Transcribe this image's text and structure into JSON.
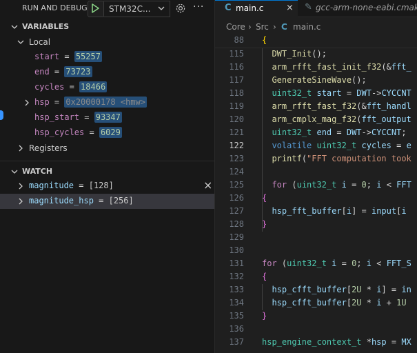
{
  "debug_toolbar": {
    "title": "RUN AND DEBUG",
    "config_label": "STM32C...",
    "play_icon": "play-icon",
    "gear_icon": "gear-icon",
    "more_label": "···"
  },
  "variables": {
    "header": "VARIABLES",
    "local_label": "Local",
    "items": [
      {
        "name": "start",
        "eq": " = ",
        "value": "55257"
      },
      {
        "name": "end",
        "eq": " = ",
        "value": "73723"
      },
      {
        "name": "cycles",
        "eq": " = ",
        "value": "18466"
      },
      {
        "name": "hsp",
        "eq": " = ",
        "value": "0x20000178 <hmw>"
      },
      {
        "name": "hsp_start",
        "eq": " = ",
        "value": "93347"
      },
      {
        "name": "hsp_cycles",
        "eq": " = ",
        "value": "6029"
      }
    ],
    "registers_label": "Registers"
  },
  "watch": {
    "header": "WATCH",
    "items": [
      {
        "name": "magnitude",
        "eq": " = ",
        "value": "[128]"
      },
      {
        "name": "magnitude_hsp",
        "eq": " = ",
        "value": "[256]"
      }
    ],
    "close_icon": "×"
  },
  "editor": {
    "tabs": [
      {
        "icon": "C",
        "label": "main.c",
        "close": "×"
      },
      {
        "icon": "C",
        "label": "gcc-arm-none-eabi.cmake"
      }
    ],
    "breadcrumb": [
      "Core",
      "Src",
      "main.c"
    ],
    "breadcrumb_sep": "›",
    "line_numbers": [
      "88",
      "115",
      "116",
      "117",
      "118",
      "119",
      "120",
      "121",
      "122",
      "123",
      "124",
      "125",
      "126",
      "127",
      "128",
      "129",
      "130",
      "131",
      "132",
      "133",
      "134",
      "135",
      "136",
      "137"
    ],
    "current_line": "122"
  },
  "colors": {
    "accent": "#0078d4",
    "selection": "#264f78",
    "play_green": "#89d185"
  }
}
